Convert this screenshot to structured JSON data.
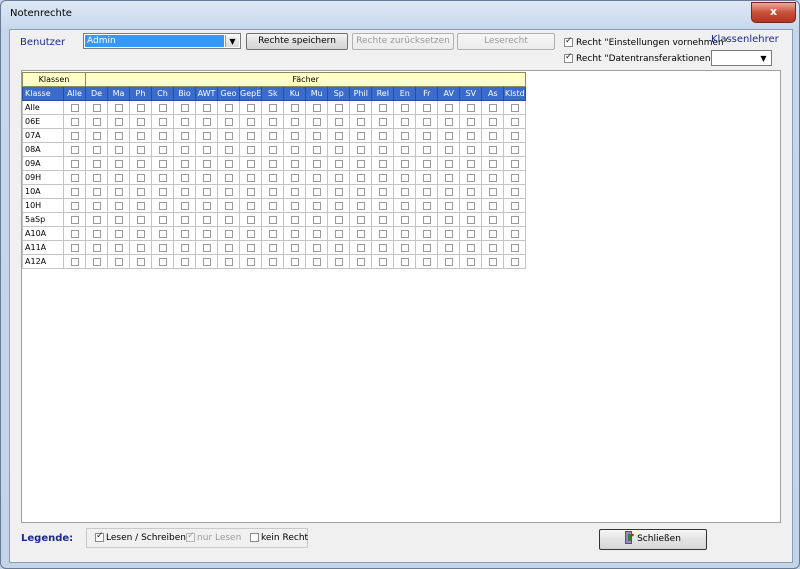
{
  "window": {
    "title": "Notenrechte",
    "close_glyph": "x"
  },
  "benutzer": {
    "label": "Benutzer",
    "value": "Admin"
  },
  "buttons": {
    "save": "Rechte speichern",
    "reset": "Rechte zurücksetzen",
    "read": "Leserecht"
  },
  "rights": {
    "settings": {
      "label": "Recht \"Einstellungen vornehmen\"",
      "checked": true
    },
    "transfer": {
      "label": "Recht \"Datentransferaktionen\"",
      "checked": true
    }
  },
  "klassenlehrer": {
    "label": "Klassenlehrer",
    "value": ""
  },
  "grid": {
    "group_klassen": "Klassen",
    "group_faecher": "Fächer",
    "header_klasse": "Klasse",
    "columns": [
      "Alle",
      "De",
      "Ma",
      "Ph",
      "Ch",
      "Bio",
      "AWT",
      "Geo",
      "GepE",
      "Sk",
      "Ku",
      "Mu",
      "Sp",
      "Phil",
      "Rel",
      "En",
      "Fr",
      "AV",
      "SV",
      "As",
      "Klstd"
    ],
    "rows": [
      "Alle",
      "06E",
      "07A",
      "08A",
      "09A",
      "09H",
      "10A",
      "10H",
      "5aSp",
      "A10A",
      "A11A",
      "A12A"
    ]
  },
  "legend": {
    "label": "Legende:",
    "items": [
      {
        "label": "Lesen / Schreiben",
        "state": "checked"
      },
      {
        "label": "nur Lesen",
        "state": "grey"
      },
      {
        "label": "kein Recht",
        "state": "empty"
      }
    ]
  },
  "close_button": {
    "label": "Schließen",
    "icon": "door-exit-icon"
  }
}
